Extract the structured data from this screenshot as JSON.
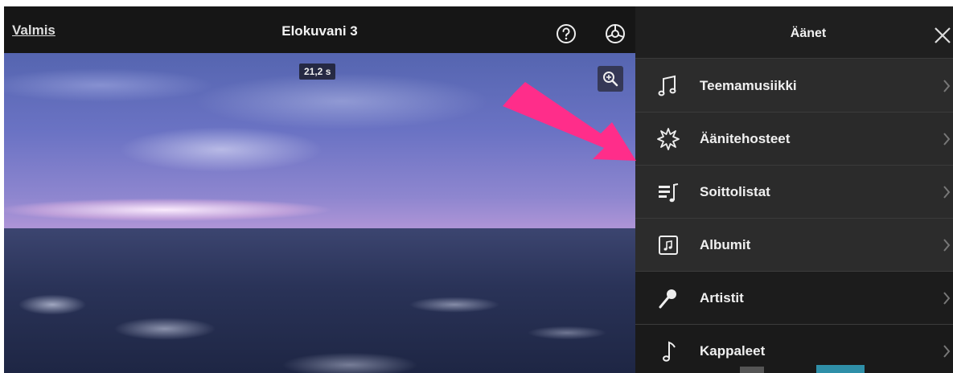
{
  "topbar": {
    "done_label": "Valmis",
    "project_title": "Elokuvani 3"
  },
  "video": {
    "duration_badge": "21,2 s"
  },
  "audio_panel": {
    "title": "Äänet",
    "items": [
      {
        "label": "Teemamusiikki",
        "icon": "music-note-icon"
      },
      {
        "label": "Äänitehosteet",
        "icon": "burst-icon"
      },
      {
        "label": "Soittolistat",
        "icon": "playlist-icon"
      },
      {
        "label": "Albumit",
        "icon": "album-icon"
      },
      {
        "label": "Artistit",
        "icon": "microphone-icon"
      },
      {
        "label": "Kappaleet",
        "icon": "single-note-icon"
      }
    ]
  },
  "colors": {
    "annotation_arrow": "#ff2d8a",
    "panel_background": "#2a2a2a",
    "topbar_background": "#161616"
  }
}
